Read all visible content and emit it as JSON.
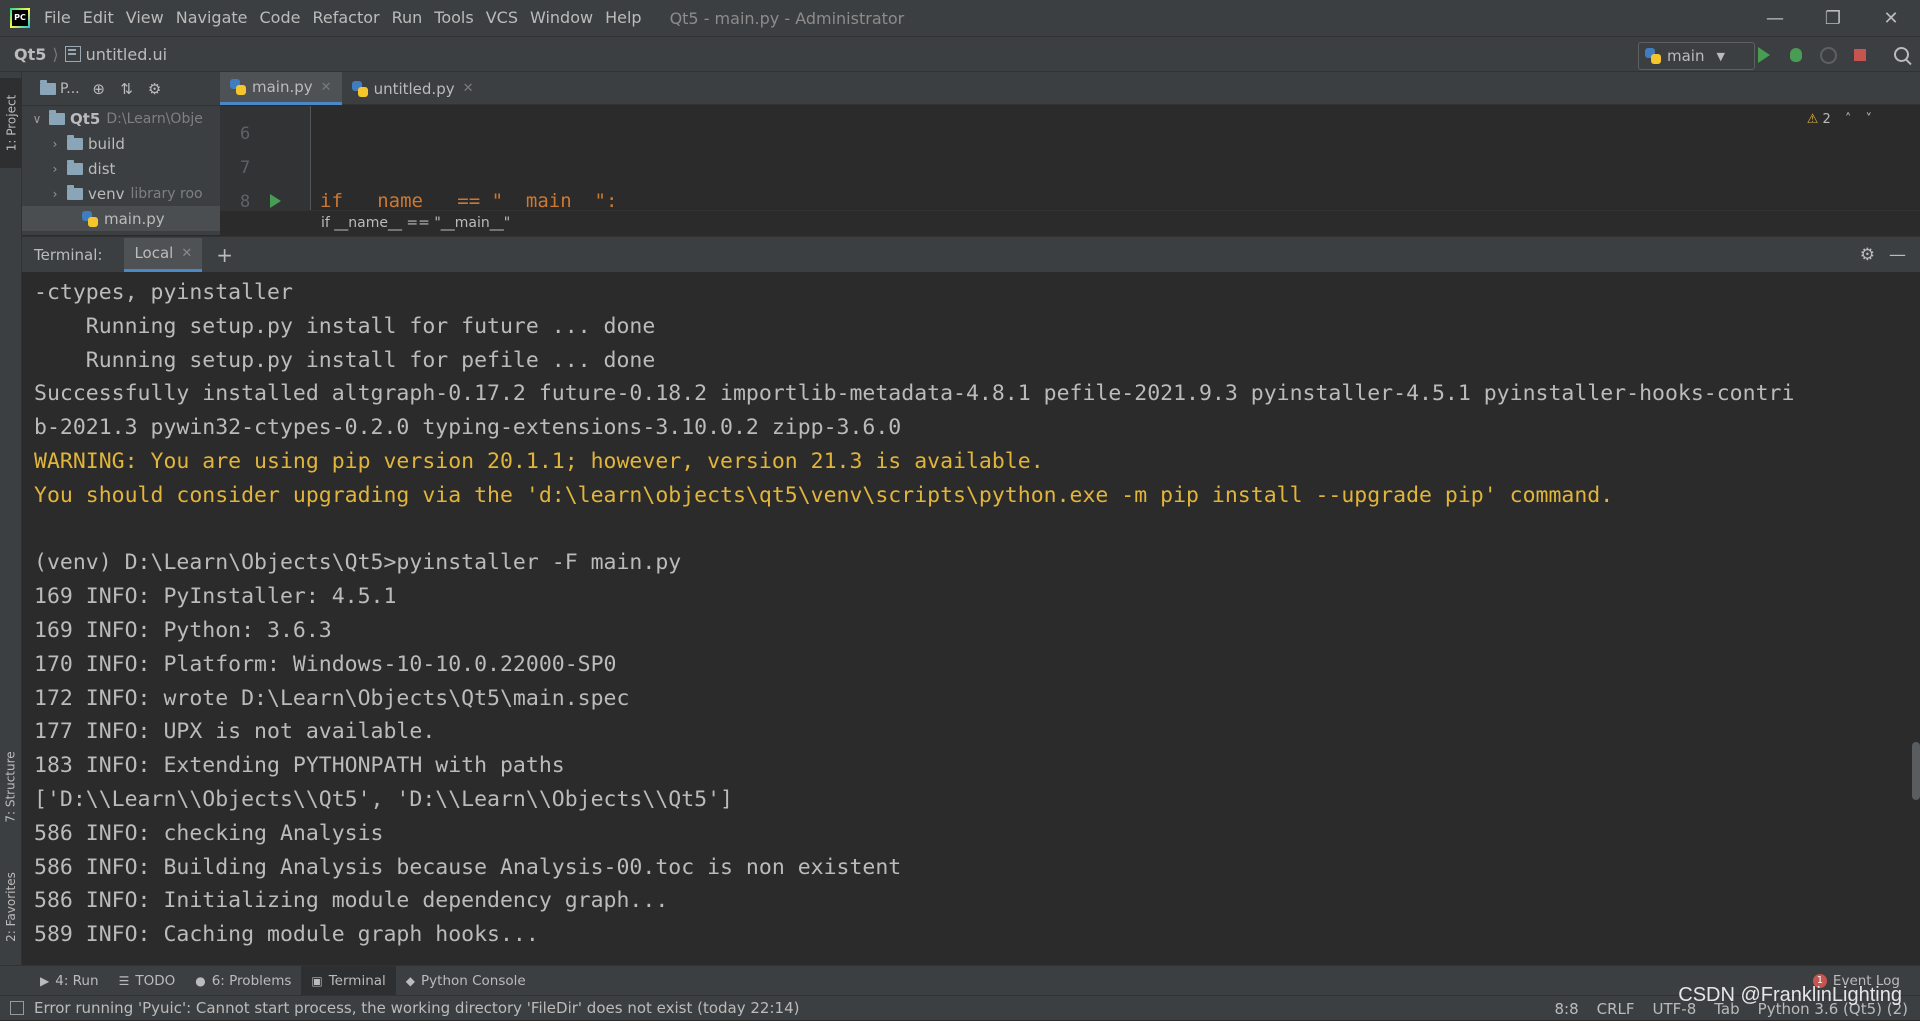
{
  "window": {
    "title": "Qt5 - main.py - Administrator",
    "menu": [
      "File",
      "Edit",
      "View",
      "Navigate",
      "Code",
      "Refactor",
      "Run",
      "Tools",
      "VCS",
      "Window",
      "Help"
    ],
    "controls": [
      "minimize-icon",
      "restore-icon",
      "close-icon"
    ]
  },
  "navbar": {
    "project": "Qt5",
    "file": "untitled.ui",
    "run_config": "main"
  },
  "left_strip": {
    "project_tab": "1: Project",
    "structure_tab": "7: Structure",
    "favorites_tab": "2: Favorites"
  },
  "project_panel": {
    "header": "P...",
    "root": {
      "name": "Qt5",
      "path": "D:\\Learn\\Obje"
    },
    "items": [
      {
        "name": "build",
        "note": ""
      },
      {
        "name": "dist",
        "note": ""
      },
      {
        "name": "venv",
        "note": "library roo"
      }
    ],
    "selected_file": "main.py"
  },
  "editor": {
    "tabs": [
      {
        "label": "main.py",
        "active": true
      },
      {
        "label": "untitled.py",
        "active": false
      }
    ],
    "line_numbers": [
      "6",
      "7",
      "8"
    ],
    "code_line": "if __name__ == \"__main__\":",
    "warning_count": "2",
    "breadcrumb": "if __name__ == \"__main__\""
  },
  "terminal": {
    "title": "Terminal:",
    "tab": "Local",
    "lines": [
      {
        "text": "-ctypes, pyinstaller",
        "kind": "normal"
      },
      {
        "text": "    Running setup.py install for future ... done",
        "kind": "normal"
      },
      {
        "text": "    Running setup.py install for pefile ... done",
        "kind": "normal"
      },
      {
        "text": "Successfully installed altgraph-0.17.2 future-0.18.2 importlib-metadata-4.8.1 pefile-2021.9.3 pyinstaller-4.5.1 pyinstaller-hooks-contri",
        "kind": "normal"
      },
      {
        "text": "b-2021.3 pywin32-ctypes-0.2.0 typing-extensions-3.10.0.2 zipp-3.6.0",
        "kind": "normal"
      },
      {
        "text": "WARNING: You are using pip version 20.1.1; however, version 21.3 is available.",
        "kind": "warn"
      },
      {
        "text": "You should consider upgrading via the 'd:\\learn\\objects\\qt5\\venv\\scripts\\python.exe -m pip install --upgrade pip' command.",
        "kind": "warn"
      },
      {
        "text": "",
        "kind": "normal"
      },
      {
        "text": "(venv) D:\\Learn\\Objects\\Qt5>pyinstaller -F main.py",
        "kind": "normal"
      },
      {
        "text": "169 INFO: PyInstaller: 4.5.1",
        "kind": "normal"
      },
      {
        "text": "169 INFO: Python: 3.6.3",
        "kind": "normal"
      },
      {
        "text": "170 INFO: Platform: Windows-10-10.0.22000-SP0",
        "kind": "normal"
      },
      {
        "text": "172 INFO: wrote D:\\Learn\\Objects\\Qt5\\main.spec",
        "kind": "normal"
      },
      {
        "text": "177 INFO: UPX is not available.",
        "kind": "normal"
      },
      {
        "text": "183 INFO: Extending PYTHONPATH with paths",
        "kind": "normal"
      },
      {
        "text": "['D:\\\\Learn\\\\Objects\\\\Qt5', 'D:\\\\Learn\\\\Objects\\\\Qt5']",
        "kind": "normal"
      },
      {
        "text": "586 INFO: checking Analysis",
        "kind": "normal"
      },
      {
        "text": "586 INFO: Building Analysis because Analysis-00.toc is non existent",
        "kind": "normal"
      },
      {
        "text": "586 INFO: Initializing module dependency graph...",
        "kind": "normal"
      },
      {
        "text": "589 INFO: Caching module graph hooks...",
        "kind": "normal"
      }
    ]
  },
  "bottom_tools": {
    "tabs": [
      {
        "label": "4: Run",
        "icon": "run-icon",
        "glyph": "▶",
        "active": false
      },
      {
        "label": "TODO",
        "icon": "todo-icon",
        "glyph": "☰",
        "active": false
      },
      {
        "label": "6: Problems",
        "icon": "problems-icon",
        "glyph": "●",
        "active": false
      },
      {
        "label": "Terminal",
        "icon": "terminal-icon",
        "glyph": "▣",
        "active": true
      },
      {
        "label": "Python Console",
        "icon": "python-console-icon",
        "glyph": "◆",
        "active": false
      }
    ],
    "event_log": "Event Log",
    "event_count": "1"
  },
  "status": {
    "message": "Error running 'Pyuic': Cannot start process, the working directory 'FileDir' does not exist (today 22:14)",
    "position": "8:8",
    "line_ending": "CRLF",
    "encoding": "UTF-8",
    "indent": "Tab",
    "interpreter": "Python 3.6 (Qt5) (2)"
  },
  "watermark": "CSDN @FranklinLighting"
}
